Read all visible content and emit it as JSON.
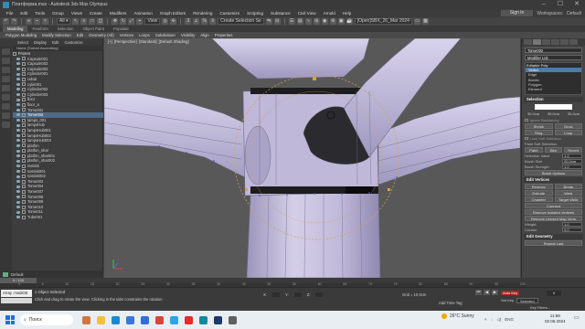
{
  "window": {
    "title": "Платформа.max - Autodesk 3ds Max Olympus",
    "controls": [
      "–",
      "☐",
      "✕"
    ]
  },
  "menu": {
    "items": [
      "File",
      "Edit",
      "Tools",
      "Group",
      "Views",
      "Create",
      "Modifiers",
      "Animation",
      "Graph Editors",
      "Rendering",
      "Customize",
      "Scripting",
      "Substance",
      "Civil View",
      "Arnold",
      "Help"
    ],
    "sign_in": "Sign In",
    "workspaces_label": "Workspaces:",
    "workspace": "Default"
  },
  "toolbar": {
    "view_dropdown": "View",
    "selection_set": "Create Selection Se",
    "version_dropdown": "[Open]SBX_26_Mar 2024"
  },
  "ribbon": {
    "tabs": [
      "Modeling",
      "Freeform",
      "Selection",
      "Object Paint",
      "Populate"
    ],
    "active_tab": "Modeling",
    "subtabs": [
      "Polygon Modeling",
      "Modify Selection",
      "Edit",
      "Geometry (All)",
      "Vertices",
      "Loops",
      "Subdivision",
      "Visibility",
      "Align",
      "Properties"
    ]
  },
  "explorer": {
    "tabs": [
      "Select",
      "Display",
      "Edit",
      "Customize"
    ],
    "column_header": "Name (Sorted Ascending)",
    "root": "Frozen",
    "objects": [
      "Capsule001",
      "Capsule002",
      "Capsule003",
      "Cylinder001",
      "cubal",
      "cylin001",
      "Cylinder002",
      "Cylinder003",
      "floor",
      "floor_a",
      "Tome001",
      "Tome002",
      "lamps_001",
      "lampsHub",
      "lampsHub001",
      "lampsHub002",
      "lampsHub003",
      "platfon",
      "platfon_shar",
      "platfon_shar001",
      "platfon_shar002",
      "sostisk",
      "sostisk001",
      "sostisk002",
      "Tome003",
      "Tome004",
      "Tome007",
      "Tome008",
      "Tome009",
      "Tome010",
      "Tome011",
      "Tube001"
    ],
    "selected_object": "Tome002",
    "layer": "Default"
  },
  "viewport": {
    "label_parts": [
      "[+]",
      "[Perspective]",
      "[Standard]",
      "[Default Shading]"
    ],
    "colors": {
      "background": "#585858",
      "mesh": "#c6c0dc",
      "mesh_shade": "#a69fc2",
      "selected_face": "#2b2b2f",
      "wire": "#6e6a86",
      "gizmo": "#d6a24a",
      "vertex": "#3a5bd8"
    }
  },
  "command_panel": {
    "object_name": "Tome002",
    "modifier_list": "Modifier List",
    "stack": [
      "Editable Poly",
      "Vertex",
      "Edge",
      "Border",
      "Polygon",
      "Element"
    ],
    "selected_stack": "Vertex",
    "selection_rollout": "Selection",
    "by_vertex": "By Vertex",
    "ignore_backfacing": "Ignore Backfacing",
    "by_angle": "By Angle",
    "by_angle_value": "45.0",
    "shrink_label": "Shrink",
    "grow_label": "Grow",
    "ring_label": "Ring",
    "loop_label": "Loop",
    "preview_selection": "Preview Selection",
    "off_label": "Off",
    "subobj_label": "SubObj",
    "multi_label": "Multi",
    "vertices_selected": "0 Vertices Selected",
    "soft_selection": "Soft Selection",
    "use_soft": "Use Soft Selection",
    "edge_distance": "Edge Distance",
    "affect_backfacing": "Affect Backfacing",
    "falloff_label": "Falloff",
    "falloff_value": "10.0cm",
    "pinch_label": "Pinch",
    "pinch_value": "0.0",
    "bubble_label": "Bubble",
    "bubble_value": "0.0",
    "shaded_face_toggle": "Shaded Face Toggle",
    "lock_soft": "Lock Soft Selection",
    "paint_soft": "Paint Soft Selection",
    "paint_label": "Paint",
    "blur_label": "Blur",
    "revert_label": "Revert",
    "selection_value_label": "Selection Value",
    "selection_value": "1.0",
    "brush_size_label": "Brush Size",
    "brush_size": "20.0cm",
    "brush_strength_label": "Brush Strength",
    "brush_strength": "1.0",
    "brush_options": "Brush Options",
    "edit_vertices": "Edit Vertices",
    "remove_label": "Remove",
    "break_label": "Break",
    "extrude_label": "Extrude",
    "weld_label": "Weld",
    "chamfer_label": "Chamfer",
    "target_weld": "Target Weld",
    "connect_label": "Connect",
    "remove_isolated": "Remove Isolated Vertices",
    "remove_unused": "Remove Unused Map Verts",
    "weight_label": "Weight:",
    "weight_value": "1.0",
    "crease_label": "Crease:",
    "crease_value": "0.0",
    "edit_geometry": "Edit Geometry",
    "repeat_last": "Repeat Last",
    "swatch_values": [
      "30.0cm",
      "30.0cm",
      "30.0cm"
    ]
  },
  "timeline": {
    "slider": "0 / 100",
    "ticks": [
      "0",
      "5",
      "10",
      "15",
      "20",
      "25",
      "30",
      "35",
      "40",
      "45",
      "50",
      "55",
      "60",
      "65",
      "70",
      "75",
      "80",
      "85",
      "90",
      "95",
      "100"
    ],
    "frame": "0"
  },
  "status": {
    "maxscript": "Array :modiOE",
    "selection_info": "1 Object Selected",
    "hint": "Click and drag to rotate the view. Clicking in the tabs constrains the rotation.",
    "x_label": "X:",
    "x_value": "",
    "y_label": "Y:",
    "y_value": "",
    "z_label": "Z:",
    "z_value": "",
    "grid": "Grid = 10,0cm",
    "add_time_tag": "Add Time Tag",
    "auto_key": "Auto Key",
    "selected": "Selected",
    "set_key": "Set Key",
    "key_filters": "Key Filters..."
  },
  "taskbar": {
    "search": "Поиск",
    "weather": "26°C  Sunny",
    "time": "11:58",
    "date": "02.06.2024",
    "lang": "ENG"
  }
}
